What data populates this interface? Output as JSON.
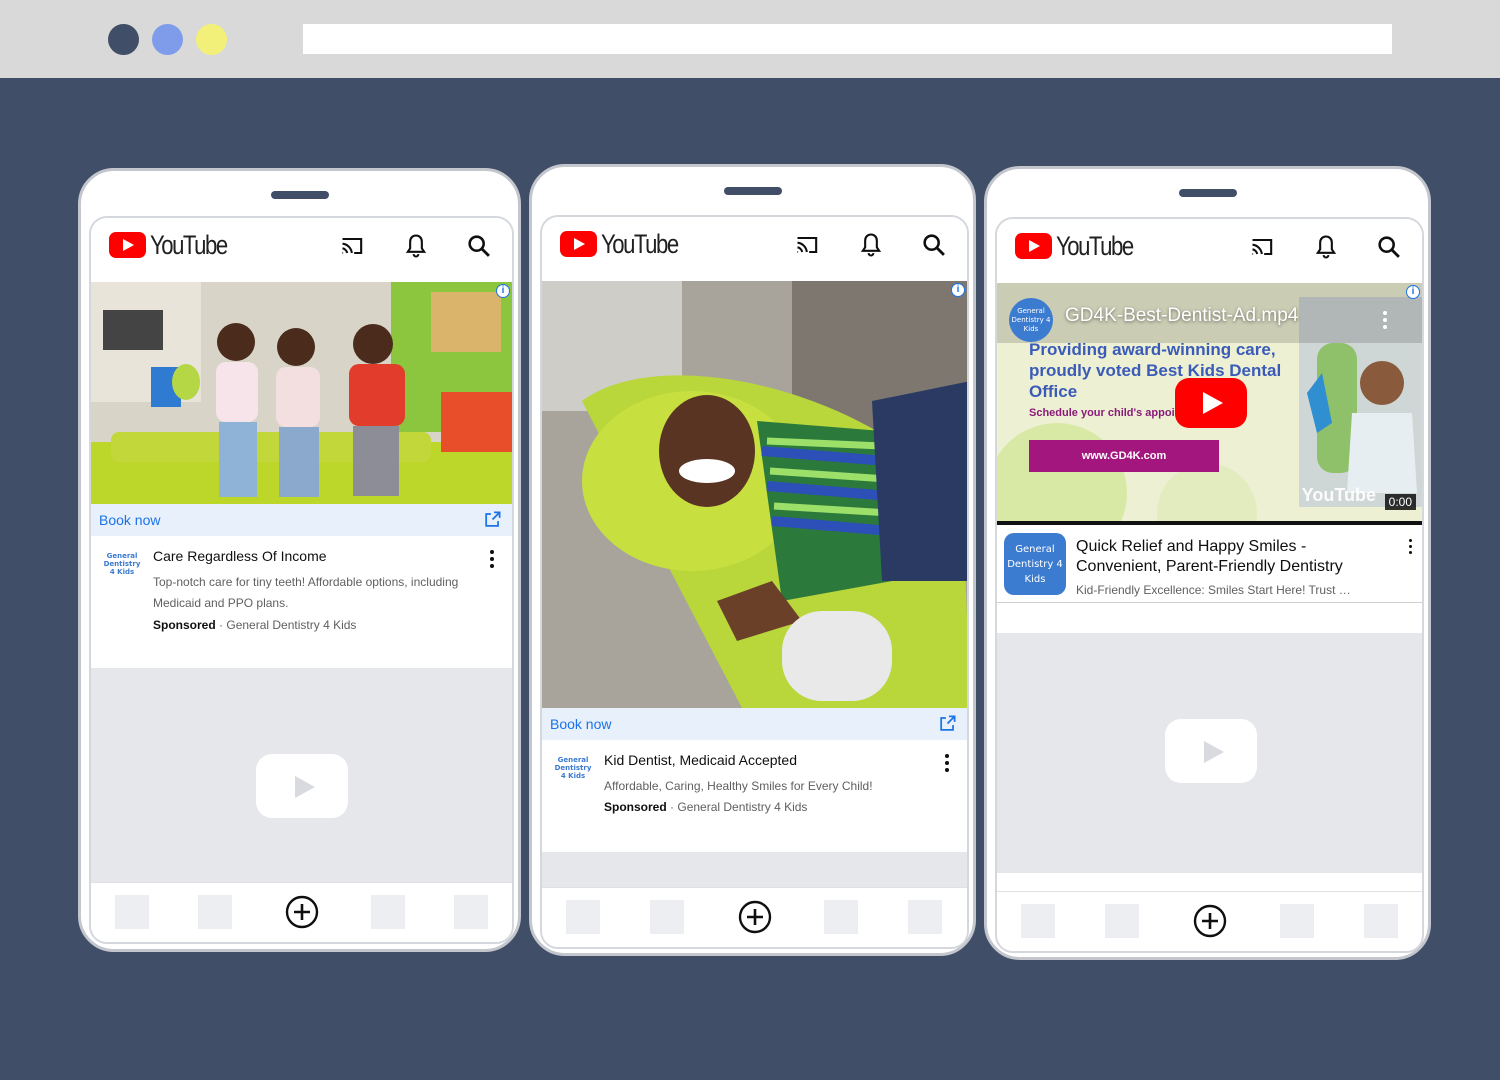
{
  "colors": {
    "background": "#404e68",
    "youtube_red": "#ff0000",
    "link_blue": "#1a73e8"
  },
  "phones": [
    {
      "header": {
        "logo_text": "YouTube"
      },
      "cta": {
        "label": "Book now"
      },
      "ad": {
        "title": "Care Regardless Of Income",
        "description": "Top-notch care for tiny teeth! Affordable options, including Medicaid and PPO plans.",
        "sponsored_label": "Sponsored",
        "separator": "·",
        "advertiser": "General Dentistry 4 Kids",
        "logo_text": "General Dentistry 4 Kids"
      }
    },
    {
      "header": {
        "logo_text": "YouTube"
      },
      "cta": {
        "label": "Book now"
      },
      "ad": {
        "title": "Kid Dentist, Medicaid Accepted",
        "description": "Affordable, Caring, Healthy Smiles for Every Child!",
        "sponsored_label": "Sponsored",
        "separator": "·",
        "advertiser": "General Dentistry 4 Kids",
        "logo_text": "General Dentistry 4 Kids"
      }
    },
    {
      "header": {
        "logo_text": "YouTube"
      },
      "video": {
        "filename": "GD4K-Best-Dentist-Ad.mp4",
        "channel_text": "General Dentistry 4 Kids",
        "heading": "Providing award-winning care, proudly voted Best Kids Dental Office",
        "schedule_text": "Schedule your child's appointment today!",
        "url": "www.GD4K.com",
        "watermark": "YouTube",
        "timestamp": "0:00"
      },
      "ad": {
        "title": "Quick Relief and Happy Smiles - Convenient, Parent-Friendly Dentistry",
        "description": "Kid-Friendly Excellence: Smiles Start Here! Trust …",
        "logo_text": "General Dentistry 4 Kids"
      }
    }
  ],
  "icons": [
    "cast-icon",
    "bell-icon",
    "search-icon",
    "external-link-icon",
    "kebab-icon",
    "add-icon",
    "info-icon",
    "play-icon"
  ]
}
